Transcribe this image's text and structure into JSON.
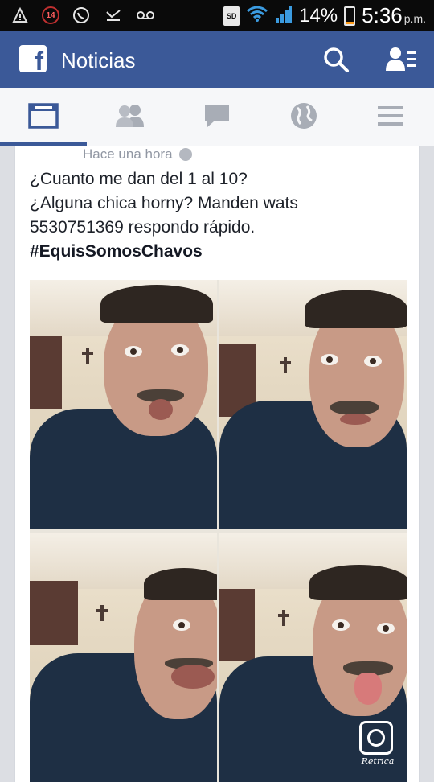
{
  "status_bar": {
    "notification_count": "14",
    "sd_label": "SD",
    "battery_percent": "14%",
    "battery_level": 0.14,
    "time": "5:36",
    "ampm": "p.m.",
    "icons": [
      "alert-icon",
      "notification-badge",
      "whatsapp-icon",
      "missed-call-icon",
      "voicemail-icon",
      "sd-card-icon",
      "wifi-icon",
      "signal-icon",
      "battery-icon"
    ]
  },
  "header": {
    "logo_letter": "f",
    "title": "Noticias",
    "color": "#3b5998"
  },
  "tabs": [
    {
      "name": "news-feed",
      "icon": "news-feed-icon",
      "active": true
    },
    {
      "name": "friend-requests",
      "icon": "friends-icon",
      "active": false
    },
    {
      "name": "messages",
      "icon": "chat-icon",
      "active": false
    },
    {
      "name": "notifications",
      "icon": "globe-icon",
      "active": false
    },
    {
      "name": "more",
      "icon": "menu-icon",
      "active": false
    }
  ],
  "post": {
    "timestamp": "Hace una hora",
    "lines": [
      "¿Cuanto me dan del 1 al 10?",
      "¿Alguna chica horny? Manden wats",
      "5530751369 respondo rápido."
    ],
    "hashtag": "#EquisSomosChavos",
    "watermark": "Retrica"
  }
}
